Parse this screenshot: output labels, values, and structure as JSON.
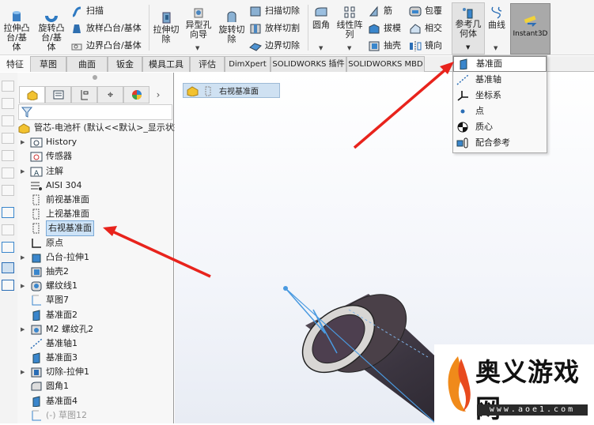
{
  "ribbon": {
    "extrude_boss": "拉伸凸台/基体",
    "revolve_boss": "旋转凸台/基体",
    "sweep": "扫描",
    "loft_boss": "放样凸台/基体",
    "boundary_boss": "边界凸台/基体",
    "extrude_cut": "拉伸切除",
    "hole_wizard": "异型孔向导",
    "revolve_cut": "旋转切除",
    "sweep_cut": "扫描切除",
    "loft_cut": "放样切割",
    "boundary_cut": "边界切除",
    "fillet": "圆角",
    "linear_pattern": "线性阵列",
    "rib": "筋",
    "draft": "拔模",
    "shell": "抽壳",
    "wrap": "包覆",
    "intersect": "相交",
    "mirror": "镜向",
    "ref_geometry": "参考几何体",
    "curves": "曲线",
    "instant3d": "Instant3D"
  },
  "tabs": [
    "特征",
    "草图",
    "曲面",
    "钣金",
    "模具工具",
    "评估",
    "DimXpert",
    "SOLIDWORKS 插件",
    "SOLIDWORKS MBD"
  ],
  "ref_menu": [
    {
      "label": "基准面",
      "icon": "plane-icon"
    },
    {
      "label": "基准轴",
      "icon": "axis-icon"
    },
    {
      "label": "坐标系",
      "icon": "coordinate-system-icon"
    },
    {
      "label": "点",
      "icon": "point-icon"
    },
    {
      "label": "质心",
      "icon": "center-of-mass-icon"
    },
    {
      "label": "配合参考",
      "icon": "mate-reference-icon"
    }
  ],
  "tree": {
    "root": "管芯-电池杆  (默认<<默认>_显示状态",
    "items": [
      {
        "label": "History",
        "icon": "history-folder-icon",
        "expand": true
      },
      {
        "label": "传感器",
        "icon": "sensor-folder-icon",
        "expand": false
      },
      {
        "label": "注解",
        "icon": "annotation-folder-icon",
        "expand": true
      },
      {
        "label": "AISI 304",
        "icon": "material-icon",
        "expand": false
      },
      {
        "label": "前视基准面",
        "icon": "plane-icon",
        "expand": false
      },
      {
        "label": "上视基准面",
        "icon": "plane-icon",
        "expand": false
      },
      {
        "label": "右视基准面",
        "icon": "plane-icon",
        "expand": false,
        "selected": true
      },
      {
        "label": "原点",
        "icon": "origin-icon",
        "expand": false
      },
      {
        "label": "凸台-拉伸1",
        "icon": "extrude-icon",
        "expand": true
      },
      {
        "label": "抽壳2",
        "icon": "shell-icon",
        "expand": false
      },
      {
        "label": "螺纹线1",
        "icon": "thread-icon",
        "expand": true
      },
      {
        "label": "草图7",
        "icon": "sketch-icon",
        "expand": false
      },
      {
        "label": "基准面2",
        "icon": "ref-plane-icon",
        "expand": false
      },
      {
        "label": "M2 螺纹孔2",
        "icon": "hole-icon",
        "expand": true
      },
      {
        "label": "基准轴1",
        "icon": "axis-icon",
        "expand": false
      },
      {
        "label": "基准面3",
        "icon": "ref-plane-icon",
        "expand": false
      },
      {
        "label": "切除-拉伸1",
        "icon": "cut-extrude-icon",
        "expand": true
      },
      {
        "label": "圆角1",
        "icon": "fillet-icon",
        "expand": false
      },
      {
        "label": "基准面4",
        "icon": "ref-plane-icon",
        "expand": false
      },
      {
        "label": "(-) 草图12",
        "icon": "sketch-icon",
        "expand": false,
        "dim": true
      }
    ]
  },
  "breadcrumb": {
    "label": "右视基准面"
  },
  "watermark": {
    "title": "奥义游戏网",
    "url": "www.aoe1.com"
  },
  "colors": {
    "accent": "#1e73c8",
    "arrow": "#e8231c",
    "selected_bg": "#cde3f7"
  }
}
